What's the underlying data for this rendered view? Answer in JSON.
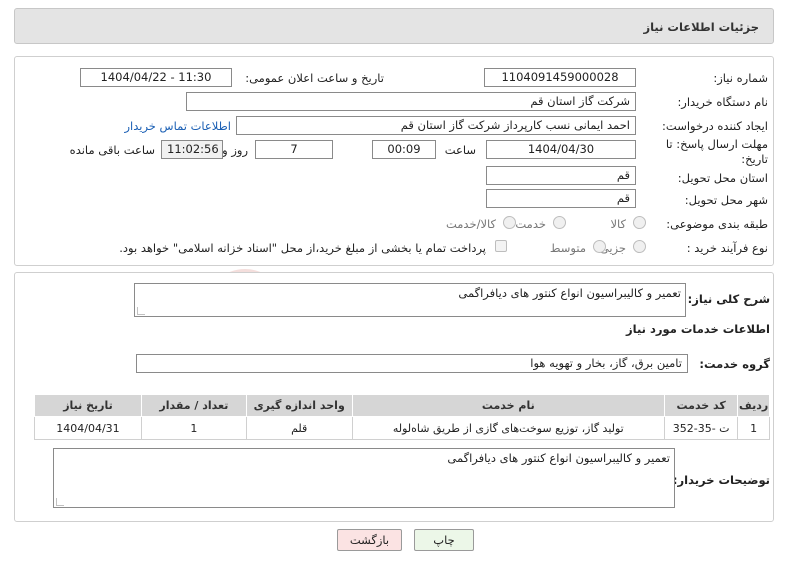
{
  "header": {
    "title": "جزئیات اطلاعات نیاز"
  },
  "form": {
    "need_number_label": "شماره نیاز:",
    "need_number": "1104091459000028",
    "announce_label": "تاریخ و ساعت اعلان عمومی:",
    "announce_value": "1404/04/22 - 11:30",
    "buyer_org_label": "نام دستگاه خریدار:",
    "buyer_org": "شرکت گاز استان قم",
    "creator_label": "ایجاد کننده درخواست:",
    "creator": "احمد ایمانی نسب کارپرداز شرکت گاز استان قم",
    "contact_link": "اطلاعات تماس خریدار",
    "deadline_label_1": "مهلت ارسال پاسخ: تا",
    "deadline_label_2": "تاریخ:",
    "deadline_date": "1404/04/30",
    "time_label": "ساعت",
    "deadline_time": "00:09",
    "days_value": "7",
    "days_label": "روز و",
    "remaining_time": "11:02:56",
    "remaining_label": "ساعت باقی مانده",
    "province_label": "استان محل تحویل:",
    "province": "قم",
    "city_label": "شهر محل تحویل:",
    "city": "قم",
    "category_label": "طبقه بندی موضوعی:",
    "category_options": [
      "کالا",
      "خدمت",
      "کالا/خدمت"
    ],
    "purchase_type_label": "نوع فرآیند خرید :",
    "purchase_options": [
      "جزیی",
      "متوسط"
    ],
    "payment_note": "پرداخت تمام یا بخشی از مبلغ خرید،از محل \"اسناد خزانه اسلامی\" خواهد بود."
  },
  "summary": {
    "label": "شرح کلی نیاز:",
    "text": "تعمیر و کالیبراسیون انواع کنتور های دیافراگمی"
  },
  "services": {
    "section_title": "اطلاعات خدمات مورد نیاز",
    "group_label": "گروه خدمت:",
    "group_value": "تامین برق، گاز، بخار و تهویه هوا",
    "columns": [
      "ردیف",
      "کد خدمت",
      "نام خدمت",
      "واحد اندازه گیری",
      "تعداد / مقدار",
      "تاریخ نیاز"
    ],
    "rows": [
      {
        "row": "1",
        "code": "ت -35-352",
        "name": "تولید گاز، توزیع سوخت‌های گازی از طریق شاه‌لوله",
        "unit": "قلم",
        "qty": "1",
        "date": "1404/04/31"
      }
    ]
  },
  "buyer_notes": {
    "label": "توضیحات خریدار:",
    "text": "تعمیر و کالیبراسیون انواع کنتور های دیافراگمی"
  },
  "buttons": {
    "print": "چاپ",
    "back": "بازگشت"
  },
  "watermark": {
    "text": "AriaTender.neT"
  },
  "colors": {
    "link": "#1a5fb4",
    "back_button_bg": "#fbe3e3",
    "print_button_bg": "#ecf7e8",
    "watermark": "#c0392b"
  }
}
